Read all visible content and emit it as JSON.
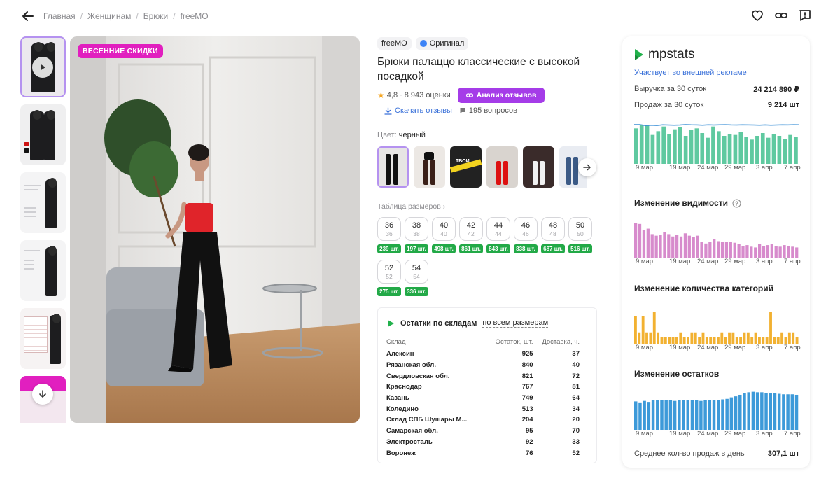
{
  "breadcrumbs": [
    "Главная",
    "Женщинам",
    "Брюки",
    "freeMO"
  ],
  "promo_badge": "ВЕСЕННИЕ СКИДКИ",
  "product": {
    "brand": "freeMO",
    "original_label": "Оригинал",
    "title": "Брюки палаццо классические с высокой посадкой",
    "rating": "4,8",
    "reviews_count": "8 943 оценки",
    "reviews_button": "Анализ отзывов",
    "download_reviews": "Скачать отзывы",
    "questions": "195 вопросов",
    "color_label": "Цвет:",
    "color_value": "черный",
    "size_table_label": "Таблица размеров",
    "sizes": [
      {
        "size": "36",
        "ru": "36",
        "stock": "239 шт."
      },
      {
        "size": "38",
        "ru": "38",
        "stock": "197 шт."
      },
      {
        "size": "40",
        "ru": "40",
        "stock": "498 шт."
      },
      {
        "size": "42",
        "ru": "42",
        "stock": "861 шт."
      },
      {
        "size": "44",
        "ru": "44",
        "stock": "843 шт."
      },
      {
        "size": "46",
        "ru": "46",
        "stock": "838 шт."
      },
      {
        "size": "48",
        "ru": "48",
        "stock": "687 шт."
      },
      {
        "size": "50",
        "ru": "50",
        "stock": "516 шт."
      },
      {
        "size": "52",
        "ru": "52",
        "stock": "275 шт."
      },
      {
        "size": "54",
        "ru": "54",
        "stock": "336 шт."
      }
    ]
  },
  "warehouse": {
    "title": "Остатки по складам",
    "filter": "по всем размерам",
    "columns": [
      "Склад",
      "Остаток, шт.",
      "Доставка, ч."
    ],
    "rows": [
      [
        "Алексин",
        "925",
        "37"
      ],
      [
        "Рязанская обл.",
        "840",
        "40"
      ],
      [
        "Свердловская обл.",
        "821",
        "72"
      ],
      [
        "Краснодар",
        "767",
        "81"
      ],
      [
        "Казань",
        "749",
        "64"
      ],
      [
        "Коледино",
        "513",
        "34"
      ],
      [
        "Склад СПБ Шушары М...",
        "204",
        "20"
      ],
      [
        "Самарская обл.",
        "95",
        "70"
      ],
      [
        "Электросталь",
        "92",
        "33"
      ],
      [
        "Воронеж",
        "76",
        "52"
      ]
    ]
  },
  "mpstats": {
    "logo": "mpstats",
    "ad_note": "Участвует во внешней рекламе",
    "revenue_label": "Выручка за 30 суток",
    "revenue_value": "24 214 890 ₽",
    "sales_label": "Продаж за 30 суток",
    "sales_value": "9 214 шт",
    "visibility_title": "Изменение видимости",
    "categories_title": "Изменение количества категорий",
    "stock_title": "Изменение остатков",
    "avg_sales_label": "Среднее кол-во продаж в день",
    "avg_sales_value": "307,1 шт",
    "x_labels": [
      "9 мар",
      "19 мар",
      "24 мар",
      "29 мар",
      "3 апр",
      "7 апр"
    ],
    "colors": {
      "sales": "#5fc9a0",
      "sales_line": "#3a8fd6",
      "visibility": "#d78bcc",
      "categories": "#f2b131",
      "stock": "#3d9ad9"
    }
  },
  "chart_data": [
    {
      "type": "bar",
      "title": "",
      "series": [
        {
          "name": "",
          "values": [
            380,
            420,
            410,
            310,
            350,
            400,
            320,
            370,
            390,
            300,
            360,
            380,
            330,
            280,
            400,
            350,
            300,
            320,
            310,
            340,
            290,
            260,
            300,
            330,
            280,
            320,
            300,
            270,
            310,
            290
          ]
        }
      ],
      "line_series": [
        420,
        420,
        410,
        415,
        412,
        418,
        416,
        414,
        416,
        420,
        418,
        417,
        415,
        418,
        416,
        418,
        419,
        417,
        416,
        418,
        417,
        416,
        414,
        417,
        415,
        416,
        418,
        417,
        419,
        418
      ],
      "ylim": [
        0,
        450
      ]
    },
    {
      "type": "bar",
      "title": "Изменение видимости",
      "series": [
        {
          "name": "",
          "values": [
            88,
            86,
            70,
            74,
            60,
            56,
            58,
            66,
            60,
            54,
            58,
            54,
            62,
            56,
            52,
            56,
            40,
            36,
            40,
            48,
            42,
            40,
            40,
            40,
            38,
            34,
            30,
            32,
            28,
            26,
            34,
            30,
            32,
            34,
            30,
            28,
            32,
            30,
            28,
            26
          ]
        }
      ],
      "ylim": [
        0,
        100
      ]
    },
    {
      "type": "bar",
      "title": "Изменение количества категорий",
      "series": [
        {
          "name": "",
          "values": [
            12,
            5,
            12,
            5,
            5,
            14,
            5,
            3,
            3,
            3,
            3,
            3,
            5,
            3,
            3,
            5,
            5,
            3,
            5,
            3,
            3,
            3,
            3,
            5,
            3,
            5,
            5,
            3,
            3,
            5,
            5,
            3,
            5,
            3,
            3,
            3,
            14,
            3,
            3,
            5,
            3,
            5,
            5,
            3
          ]
        },
        {
          "name": "",
          "values": [
            0
          ]
        }
      ],
      "ylim": [
        0,
        16
      ]
    },
    {
      "type": "bar",
      "title": "Изменение остатков",
      "series": [
        {
          "name": "",
          "values": [
            5600,
            5400,
            5700,
            5500,
            5800,
            5900,
            5800,
            5900,
            5800,
            5700,
            5800,
            5900,
            5800,
            5900,
            5800,
            5700,
            5800,
            5900,
            5800,
            5900,
            6000,
            6100,
            6400,
            6600,
            6900,
            7200,
            7400,
            7500,
            7400,
            7400,
            7300,
            7300,
            7200,
            7100,
            7000,
            7000,
            7000,
            6900
          ]
        }
      ],
      "ylim": [
        0,
        8000
      ]
    }
  ]
}
